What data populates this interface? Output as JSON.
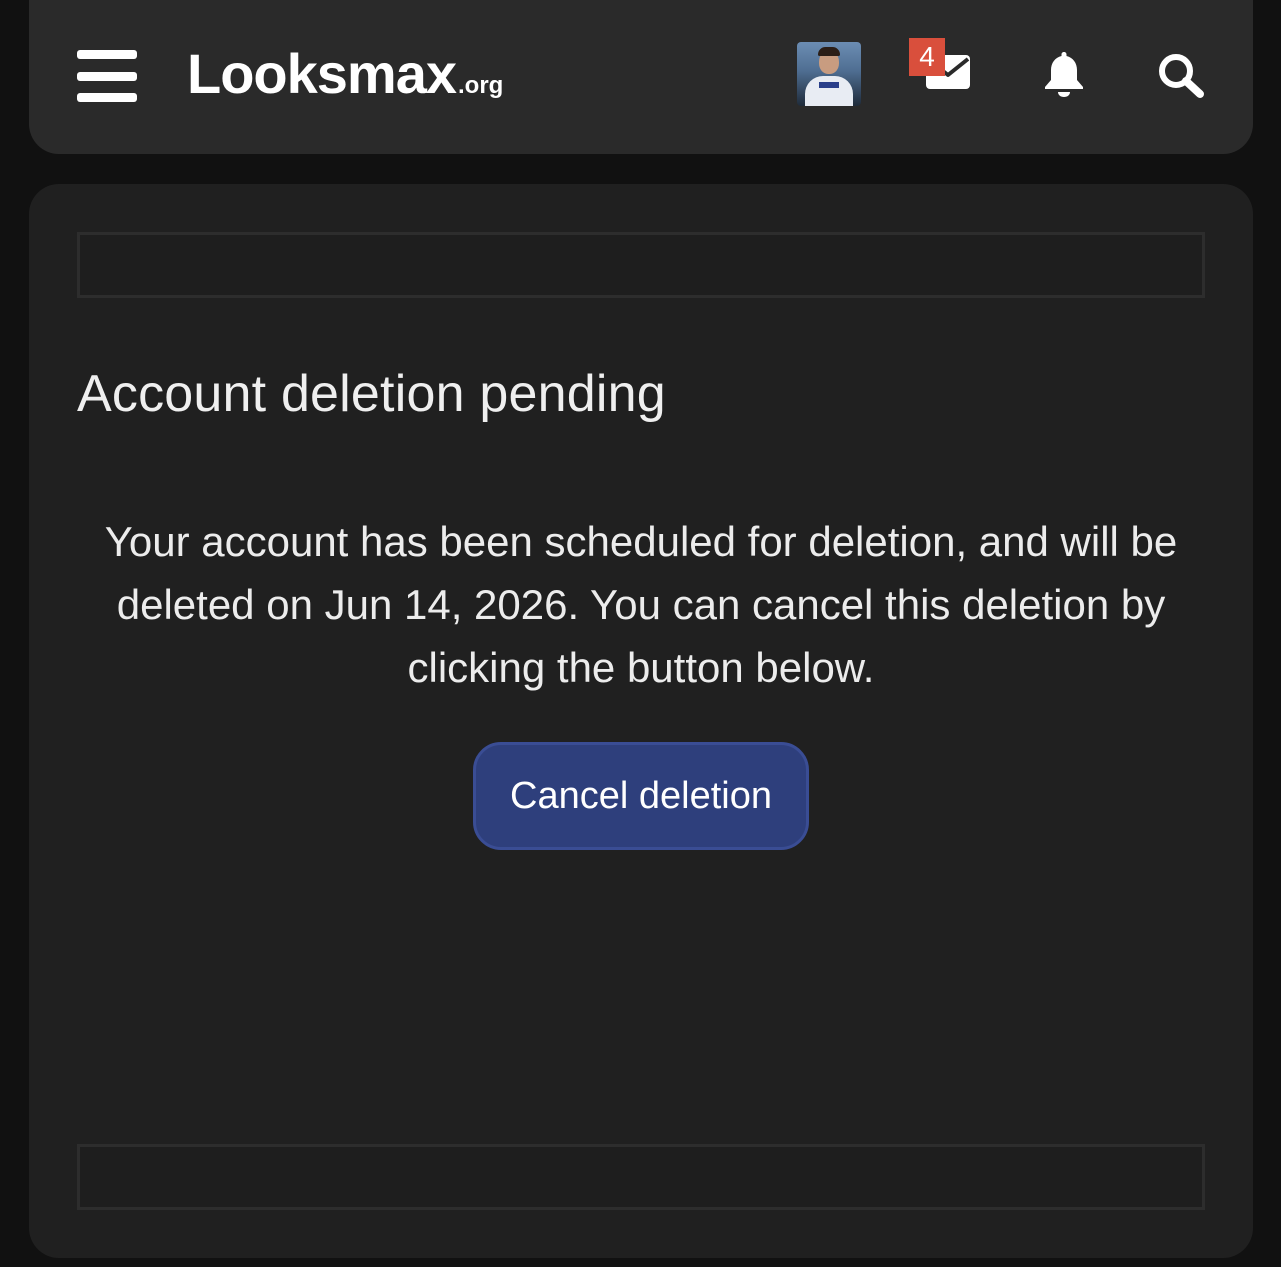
{
  "header": {
    "logo_main": "Looksmax",
    "logo_tld": ".org",
    "menu_icon": "hamburger-menu-icon",
    "avatar_icon": "user-avatar",
    "inbox": {
      "icon": "envelope-icon",
      "badge_count": "4"
    },
    "alerts_icon": "bell-icon",
    "search_icon": "search-icon"
  },
  "main": {
    "title": "Account deletion pending",
    "message": "Your account has been scheduled for deletion, and will be deleted on Jun 14, 2026. You can cancel this deletion by clicking the button below.",
    "cancel_button_label": "Cancel deletion"
  },
  "colors": {
    "page_bg": "#111111",
    "header_bg": "#2a2a2a",
    "panel_bg": "#202020",
    "button_bg": "#2e3f7c",
    "badge_bg": "#d94f3c"
  }
}
